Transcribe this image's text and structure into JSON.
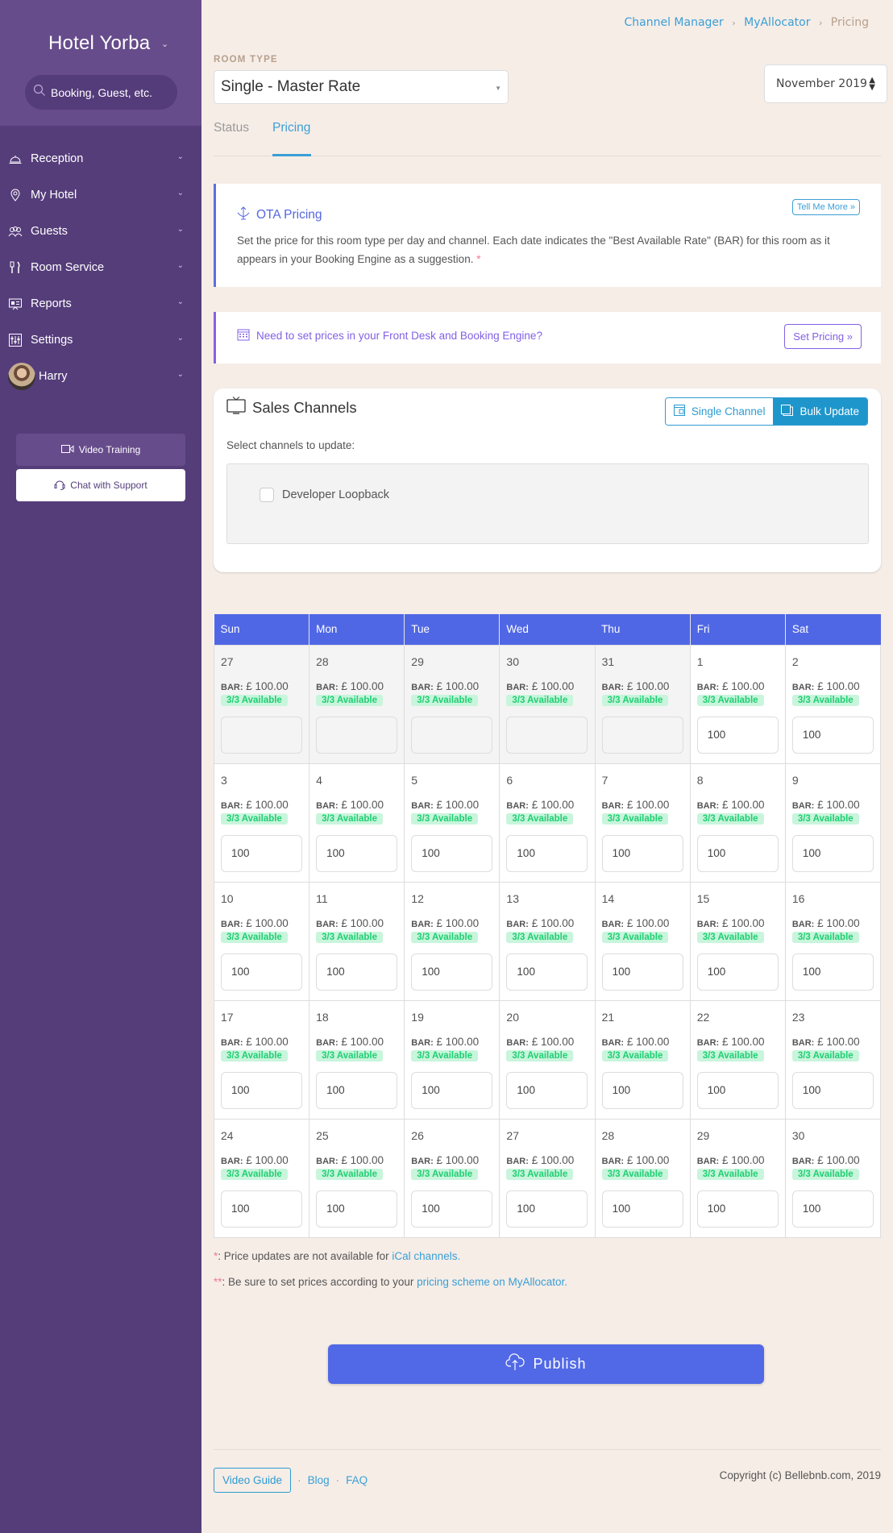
{
  "sidebar": {
    "hotel_name": "Hotel Yorba",
    "search_placeholder": "Booking, Guest, etc.",
    "nav": [
      {
        "label": "Reception",
        "icon": "bell-icon"
      },
      {
        "label": "My Hotel",
        "icon": "map-pin-icon"
      },
      {
        "label": "Guests",
        "icon": "guests-icon"
      },
      {
        "label": "Room Service",
        "icon": "cutlery-icon"
      },
      {
        "label": "Reports",
        "icon": "presentation-icon"
      },
      {
        "label": "Settings",
        "icon": "sliders-icon"
      }
    ],
    "user": {
      "name": "Harry"
    },
    "video_training": "Video Training",
    "chat_support": "Chat with Support"
  },
  "breadcrumb": {
    "items": [
      "Channel Manager",
      "MyAllocator"
    ],
    "current": "Pricing",
    "separator": "›"
  },
  "room_type": {
    "label": "ROOM TYPE",
    "value": "Single - Master Rate"
  },
  "month_select": {
    "value": "November 2019"
  },
  "tabs": [
    {
      "label": "Status",
      "active": false
    },
    {
      "label": "Pricing",
      "active": true
    }
  ],
  "ota": {
    "title": "OTA Pricing",
    "tell_more": "Tell Me More »",
    "description": "Set the price for this room type per day and channel. Each date indicates the \"Best Available Rate\" (BAR) for this room as it appears in your Booking Engine as a suggestion.",
    "asterisk": "*"
  },
  "front_desk": {
    "message": "Need to set prices in your Front Desk and Booking Engine?",
    "button": "Set Pricing »"
  },
  "sales_channels": {
    "title": "Sales Channels",
    "single_channel": "Single Channel",
    "bulk_update": "Bulk Update",
    "select_label": "Select channels to update:",
    "channels": [
      {
        "name": "Developer Loopback",
        "checked": false
      }
    ]
  },
  "calendar": {
    "weekdays": [
      "Sun",
      "Mon",
      "Tue",
      "Wed",
      "Thu",
      "Fri",
      "Sat"
    ],
    "bar_label": "BAR:",
    "weeks": [
      [
        {
          "day": "27",
          "bar": "£ 100.00",
          "avail": "3/3 Available",
          "price": "",
          "prev": true
        },
        {
          "day": "28",
          "bar": "£ 100.00",
          "avail": "3/3 Available",
          "price": "",
          "prev": true
        },
        {
          "day": "29",
          "bar": "£ 100.00",
          "avail": "3/3 Available",
          "price": "",
          "prev": true
        },
        {
          "day": "30",
          "bar": "£ 100.00",
          "avail": "3/3 Available",
          "price": "",
          "prev": true
        },
        {
          "day": "31",
          "bar": "£ 100.00",
          "avail": "3/3 Available",
          "price": "",
          "prev": true
        },
        {
          "day": "1",
          "bar": "£ 100.00",
          "avail": "3/3 Available",
          "price": "100",
          "prev": false
        },
        {
          "day": "2",
          "bar": "£ 100.00",
          "avail": "3/3 Available",
          "price": "100",
          "prev": false
        }
      ],
      [
        {
          "day": "3",
          "bar": "£ 100.00",
          "avail": "3/3 Available",
          "price": "100",
          "prev": false
        },
        {
          "day": "4",
          "bar": "£ 100.00",
          "avail": "3/3 Available",
          "price": "100",
          "prev": false
        },
        {
          "day": "5",
          "bar": "£ 100.00",
          "avail": "3/3 Available",
          "price": "100",
          "prev": false
        },
        {
          "day": "6",
          "bar": "£ 100.00",
          "avail": "3/3 Available",
          "price": "100",
          "prev": false
        },
        {
          "day": "7",
          "bar": "£ 100.00",
          "avail": "3/3 Available",
          "price": "100",
          "prev": false
        },
        {
          "day": "8",
          "bar": "£ 100.00",
          "avail": "3/3 Available",
          "price": "100",
          "prev": false
        },
        {
          "day": "9",
          "bar": "£ 100.00",
          "avail": "3/3 Available",
          "price": "100",
          "prev": false
        }
      ],
      [
        {
          "day": "10",
          "bar": "£ 100.00",
          "avail": "3/3 Available",
          "price": "100",
          "prev": false
        },
        {
          "day": "11",
          "bar": "£ 100.00",
          "avail": "3/3 Available",
          "price": "100",
          "prev": false
        },
        {
          "day": "12",
          "bar": "£ 100.00",
          "avail": "3/3 Available",
          "price": "100",
          "prev": false
        },
        {
          "day": "13",
          "bar": "£ 100.00",
          "avail": "3/3 Available",
          "price": "100",
          "prev": false
        },
        {
          "day": "14",
          "bar": "£ 100.00",
          "avail": "3/3 Available",
          "price": "100",
          "prev": false
        },
        {
          "day": "15",
          "bar": "£ 100.00",
          "avail": "3/3 Available",
          "price": "100",
          "prev": false
        },
        {
          "day": "16",
          "bar": "£ 100.00",
          "avail": "3/3 Available",
          "price": "100",
          "prev": false
        }
      ],
      [
        {
          "day": "17",
          "bar": "£ 100.00",
          "avail": "3/3 Available",
          "price": "100",
          "prev": false
        },
        {
          "day": "18",
          "bar": "£ 100.00",
          "avail": "3/3 Available",
          "price": "100",
          "prev": false
        },
        {
          "day": "19",
          "bar": "£ 100.00",
          "avail": "3/3 Available",
          "price": "100",
          "prev": false
        },
        {
          "day": "20",
          "bar": "£ 100.00",
          "avail": "3/3 Available",
          "price": "100",
          "prev": false
        },
        {
          "day": "21",
          "bar": "£ 100.00",
          "avail": "3/3 Available",
          "price": "100",
          "prev": false
        },
        {
          "day": "22",
          "bar": "£ 100.00",
          "avail": "3/3 Available",
          "price": "100",
          "prev": false
        },
        {
          "day": "23",
          "bar": "£ 100.00",
          "avail": "3/3 Available",
          "price": "100",
          "prev": false
        }
      ],
      [
        {
          "day": "24",
          "bar": "£ 100.00",
          "avail": "3/3 Available",
          "price": "100",
          "prev": false
        },
        {
          "day": "25",
          "bar": "£ 100.00",
          "avail": "3/3 Available",
          "price": "100",
          "prev": false
        },
        {
          "day": "26",
          "bar": "£ 100.00",
          "avail": "3/3 Available",
          "price": "100",
          "prev": false
        },
        {
          "day": "27",
          "bar": "£ 100.00",
          "avail": "3/3 Available",
          "price": "100",
          "prev": false
        },
        {
          "day": "28",
          "bar": "£ 100.00",
          "avail": "3/3 Available",
          "price": "100",
          "prev": false
        },
        {
          "day": "29",
          "bar": "£ 100.00",
          "avail": "3/3 Available",
          "price": "100",
          "prev": false
        },
        {
          "day": "30",
          "bar": "£ 100.00",
          "avail": "3/3 Available",
          "price": "100",
          "prev": false
        }
      ]
    ]
  },
  "notes": {
    "note1_star": "*",
    "note1_text": ": Price updates are not available for ",
    "note1_link": "iCal channels.",
    "note2_star": "**",
    "note2_text": ": Be sure to set prices according to your ",
    "note2_link": "pricing scheme on MyAllocator."
  },
  "publish": "Publish",
  "footer": {
    "video_guide": "Video Guide",
    "blog": "Blog",
    "faq": "FAQ",
    "separator": "·",
    "copyright": "Copyright (c) Bellebnb.com, 2019"
  },
  "colors": {
    "sidebar": "#553d7a",
    "sidebar_top": "#674c8c",
    "accent_blue": "#3a9fd6",
    "calendar_header": "#5067e5",
    "publish": "#5169e6",
    "available_bg": "#c8f5dc",
    "available_text": "#1fcf72"
  }
}
